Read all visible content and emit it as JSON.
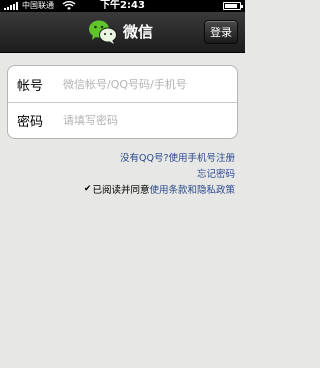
{
  "status_bar": {
    "carrier": "中国联通",
    "time": "下午2:43",
    "battery_level": 0.85
  },
  "nav": {
    "app_name": "微信",
    "login_button": "登录"
  },
  "form": {
    "account_label": "帐号",
    "account_placeholder": "微信帐号/QQ号码/手机号",
    "password_label": "密码",
    "password_placeholder": "请填写密码"
  },
  "links": {
    "register": "没有QQ号?使用手机号注册",
    "forgot_password": "忘记密码",
    "agree_prefix": "已阅读并同意",
    "terms": "使用条款和隐私政策"
  },
  "icons": {
    "signal": "signal-bars-icon",
    "wifi": "wifi-icon",
    "battery": "battery-icon",
    "logo": "wechat-logo-icon",
    "checkbox": "checkmark-icon"
  },
  "colors": {
    "background": "#e7e7e5",
    "navbar": "#2a2a2a",
    "link": "#2c4a8c",
    "logo_green": "#5fc52a"
  }
}
